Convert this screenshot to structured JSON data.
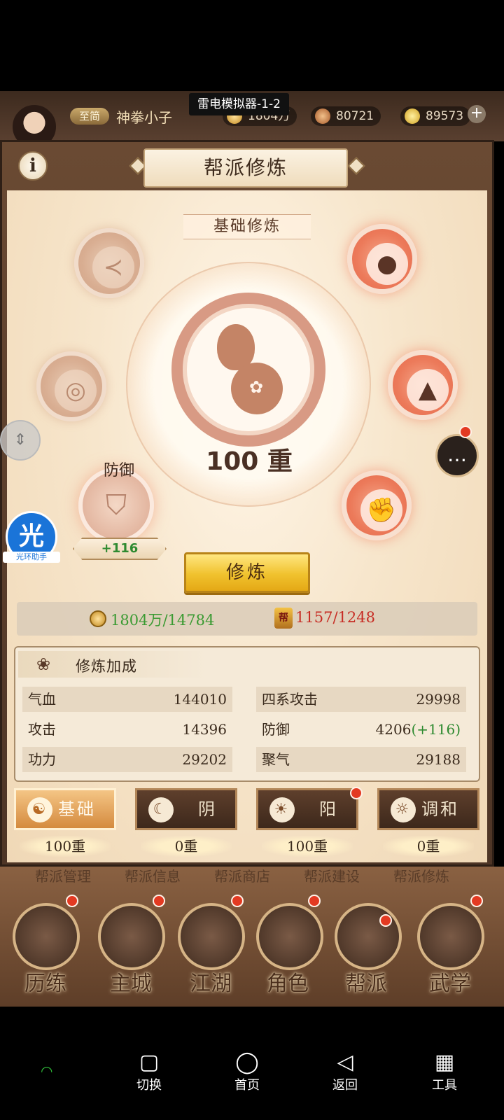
{
  "emulator": {
    "title": "雷电模拟器-1-2"
  },
  "header": {
    "vip": "至简",
    "player_name": "神拳小子",
    "coins": "1804万",
    "ingots": "80721",
    "gold": "89573",
    "plus": "+"
  },
  "panel": {
    "title": "帮派修炼",
    "info": "i",
    "subtitle": "基础修炼",
    "current_level_num": "100",
    "current_level_unit": "重",
    "selected_attr": "防御",
    "selected_bonus": "+116",
    "cultivate_button": "修炼",
    "cost_coins": "1804万/14784",
    "cost_tokens": "1157/1248"
  },
  "stats": {
    "title": "修炼加成",
    "rows": [
      {
        "label": "气血",
        "value": "144010"
      },
      {
        "label": "四系攻击",
        "value": "29998"
      },
      {
        "label": "攻击",
        "value": "14396"
      },
      {
        "label": "防御",
        "value": "4206",
        "bonus": "(+116)"
      },
      {
        "label": "功力",
        "value": "29202"
      },
      {
        "label": "聚气",
        "value": "29188"
      }
    ]
  },
  "categories": [
    {
      "label": "基础",
      "level": "100重",
      "icon": "gourd-icon",
      "active": true
    },
    {
      "label": "阴",
      "level": "0重",
      "icon": "moon-icon"
    },
    {
      "label": "阳",
      "level": "100重",
      "icon": "sun-icon"
    },
    {
      "label": "调和",
      "level": "0重",
      "icon": "sun-moon-icon"
    }
  ],
  "game_nav": {
    "sub_tabs": [
      "帮派管理",
      "帮派信息",
      "帮派商店",
      "帮派建设",
      "帮派修炼"
    ],
    "items": [
      "历练",
      "主城",
      "江湖",
      "角色",
      "帮派",
      "武学"
    ]
  },
  "overlays": {
    "helper_char": "光",
    "helper_label": "光环助手"
  },
  "android_nav": [
    "切换",
    "首页",
    "返回",
    "工具"
  ]
}
